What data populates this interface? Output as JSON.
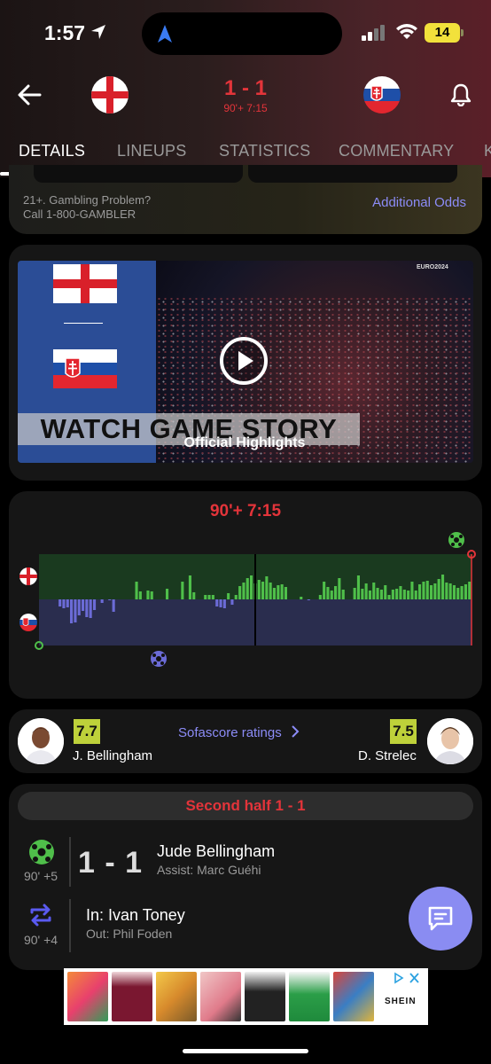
{
  "status_bar": {
    "time": "1:57",
    "battery": "14"
  },
  "header": {
    "score": "1 - 1",
    "match_time": "90'+ 7:15"
  },
  "tabs": [
    {
      "label": "DETAILS",
      "active": true
    },
    {
      "label": "LINEUPS",
      "active": false
    },
    {
      "label": "STATISTICS",
      "active": false
    },
    {
      "label": "COMMENTARY",
      "active": false
    },
    {
      "label": "K",
      "active": false
    }
  ],
  "odds": {
    "disclaimer_line1": "21+. Gambling Problem?",
    "disclaimer_line2": "Call 1-800-GAMBLER",
    "link": "Additional Odds"
  },
  "video": {
    "banner": "WATCH GAME STORY",
    "caption": "Official Highlights",
    "logo_text": "EURO2024"
  },
  "momentum": {
    "time": "90'+ 7:15",
    "values": [
      0,
      0,
      0,
      0,
      0,
      -8,
      -10,
      -9,
      -27,
      -26,
      -18,
      -13,
      -20,
      -21,
      -12,
      0,
      -4,
      0,
      -1,
      -14,
      0,
      0,
      0,
      0,
      0,
      20,
      9,
      0,
      10,
      9,
      0,
      0,
      0,
      12,
      0,
      0,
      0,
      20,
      0,
      27,
      8,
      0,
      0,
      5,
      5,
      5,
      -8,
      -9,
      -10,
      7,
      -6,
      5,
      15,
      19,
      24,
      27,
      18,
      22,
      20,
      26,
      19,
      13,
      16,
      17,
      14,
      0,
      0,
      0,
      3,
      0,
      -1,
      0,
      0,
      5,
      20,
      14,
      10,
      15,
      24,
      11,
      0,
      0,
      13,
      27,
      12,
      18,
      10,
      19,
      13,
      11,
      16,
      5,
      11,
      12,
      15,
      11,
      10,
      20,
      10,
      17,
      20,
      21,
      16,
      18,
      23,
      28,
      19,
      18,
      16,
      13,
      15,
      17,
      20
    ],
    "halftime_fraction": 0.5
  },
  "ratings": {
    "link": "Sofascore ratings",
    "home": {
      "name": "J. Bellingham",
      "rating": "7.7"
    },
    "away": {
      "name": "D. Strelec",
      "rating": "7.5"
    }
  },
  "events": {
    "half_label": "Second half 1 - 1",
    "goal": {
      "minute": "90' +5",
      "score": "1 - 1",
      "player": "Jude Bellingham",
      "assist": "Assist: Marc Guéhi"
    },
    "sub": {
      "minute": "90' +4",
      "in": "In: Ivan Toney",
      "out": "Out: Phil Foden"
    }
  },
  "ad": {
    "brand": "SHEIN"
  },
  "colors": {
    "accent_red": "#e3343a",
    "link_purple": "#8c8cf7",
    "rating_green": "#bed13a",
    "home_bar": "#4fbf4a",
    "away_bar": "#6b6bd6"
  }
}
